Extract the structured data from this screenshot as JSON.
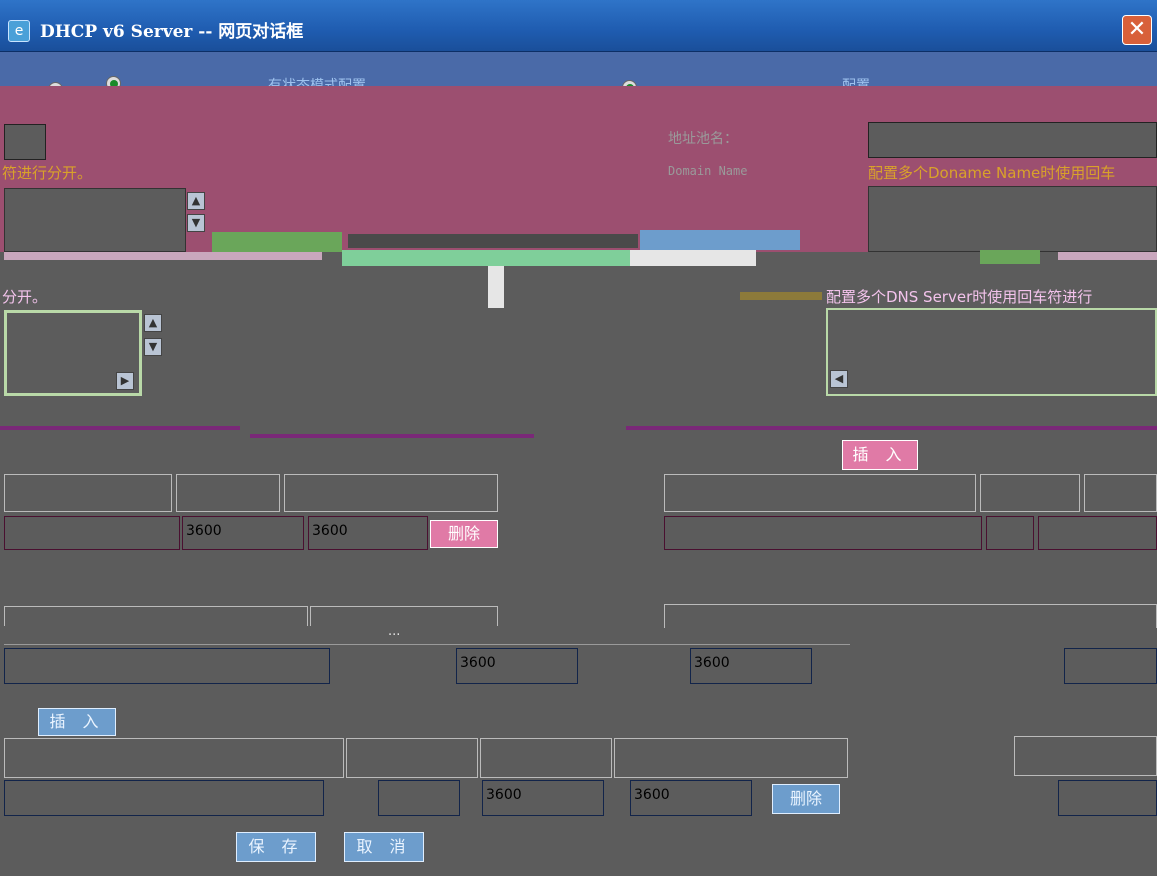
{
  "window": {
    "title": "DHCP v6 Server -- 网页对话框",
    "close_glyph": "✕"
  },
  "mode": {
    "option1_label": "有状态模式配置",
    "option2_label": "配置",
    "selected": "option1"
  },
  "form": {
    "address_alias_label": "地址池名：",
    "domain_name_label": "Domain Name",
    "left_note_1": "符进行分开。",
    "domain_note": "配置多个Doname Name时使用回车",
    "left_note_2": "分开。",
    "dns_note": "配置多个DNS Server时使用回车符进行"
  },
  "prefix_section": {
    "insert_label": "插 入",
    "row": {
      "valid": "3600",
      "preferred": "3600",
      "delete_label": "删除"
    }
  },
  "middle_section": {
    "ellipsis": "...",
    "row": {
      "valid": "3600",
      "preferred": "3600"
    }
  },
  "bottom_section": {
    "insert_label": "插 入",
    "row": {
      "valid": "3600",
      "preferred": "3600",
      "delete_label": "删除"
    }
  },
  "footer": {
    "save_label": "保 存",
    "cancel_label": "取 消"
  },
  "colors": {
    "background": "#5c5c5c",
    "pink_panel": "#9c4f70",
    "title_bar": "#1f5cb0",
    "accent_pink": "#e07aa6",
    "accent_blue": "#6d9dcc"
  }
}
